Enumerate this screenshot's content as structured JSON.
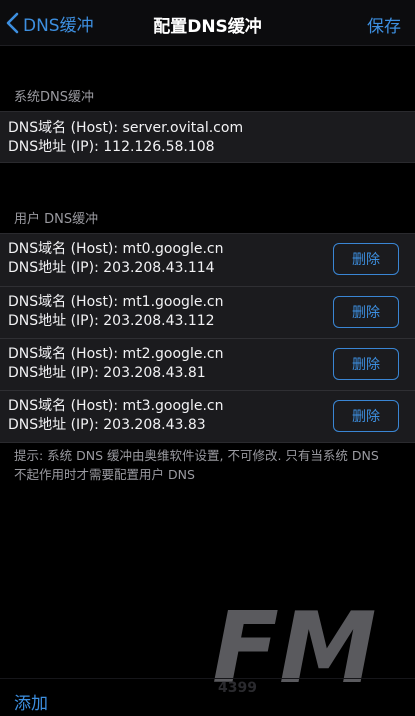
{
  "nav": {
    "back_label": "DNS缓冲",
    "title": "配置DNS缓冲",
    "save_label": "保存"
  },
  "system_section": {
    "header": "系统DNS缓冲",
    "entry": {
      "host_line": "DNS域名 (Host): server.ovital.com",
      "ip_line": "DNS地址 (IP): 112.126.58.108"
    }
  },
  "user_section": {
    "header": "用户 DNS缓冲",
    "delete_label": "删除",
    "entries": [
      {
        "host_line": "DNS域名 (Host): mt0.google.cn",
        "ip_line": "DNS地址 (IP): 203.208.43.114"
      },
      {
        "host_line": "DNS域名 (Host): mt1.google.cn",
        "ip_line": "DNS地址 (IP): 203.208.43.112"
      },
      {
        "host_line": "DNS域名 (Host): mt2.google.cn",
        "ip_line": "DNS地址 (IP): 203.208.43.81"
      },
      {
        "host_line": "DNS域名 (Host): mt3.google.cn",
        "ip_line": "DNS地址 (IP): 203.208.43.83"
      }
    ]
  },
  "hint": "提示: 系统 DNS 缓冲由奥维软件设置, 不可修改. 只有当系统 DNS 不起作用时才需要配置用户 DNS",
  "watermark": {
    "text": "FM",
    "subtext": "4399"
  },
  "bottom": {
    "add_label": "添加"
  },
  "colors": {
    "accent": "#3d8fe0",
    "background": "#000000",
    "cell": "#1b1b1e",
    "secondary_text": "#9a9aa0"
  },
  "icons": {
    "back": "chevron-left-icon"
  }
}
